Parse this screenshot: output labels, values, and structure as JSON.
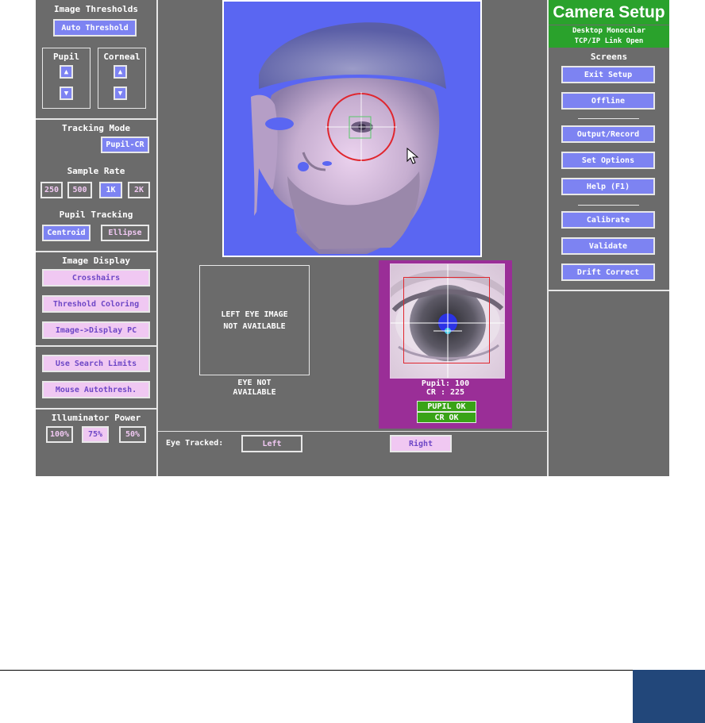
{
  "left": {
    "image_thresholds": {
      "title": "Image Thresholds",
      "auto_threshold": "Auto Threshold",
      "pupil_label": "Pupil",
      "corneal_label": "Corneal"
    },
    "tracking_mode": {
      "title": "Tracking Mode",
      "value": "Pupil-CR"
    },
    "sample_rate": {
      "title": "Sample Rate",
      "options": [
        "250",
        "500",
        "1K",
        "2K"
      ],
      "selected": "1K"
    },
    "pupil_tracking": {
      "title": "Pupil Tracking",
      "centroid": "Centroid",
      "ellipse": "Ellipse"
    },
    "image_display": {
      "title": "Image Display",
      "crosshairs": "Crosshairs",
      "threshold_coloring": "Threshold Coloring",
      "image_display_pc": "Image->Display PC"
    },
    "use_search_limits": "Use Search Limits",
    "mouse_autothresh": "Mouse Autothresh.",
    "illuminator": {
      "title": "Illuminator Power",
      "options": [
        "100%",
        "75%",
        "50%"
      ],
      "selected": "75%"
    }
  },
  "center": {
    "left_eye_msg_1": "LEFT EYE IMAGE",
    "left_eye_msg_2": "NOT AVAILABLE",
    "eye_not_1": "EYE NOT",
    "eye_not_2": "AVAILABLE",
    "pupil_readout": "Pupil: 100",
    "cr_readout": "CR   : 225",
    "pupil_status": "PUPIL OK",
    "cr_status": "CR   OK",
    "eye_tracked_label": "Eye Tracked:",
    "left_btn": "Left",
    "right_btn": "Right"
  },
  "right": {
    "title": "Camera Setup",
    "subtitle_1": "Desktop Monocular",
    "subtitle_2": "TCP/IP Link Open",
    "screens_label": "Screens",
    "buttons": {
      "exit_setup": "Exit Setup",
      "offline": "Offline",
      "output_record": "Output/Record",
      "set_options": "Set Options",
      "help": "Help (F1)",
      "calibrate": "Calibrate",
      "validate": "Validate",
      "drift_correct": "Drift Correct"
    }
  },
  "colors": {
    "panel_gray": "#6b6b6b",
    "button_blue": "#7d83f2",
    "button_pink": "#f0c8f2",
    "header_green": "#2aa22c",
    "status_green": "#39a317",
    "eye_panel_purple": "#9a2e97",
    "footer_blue": "#22477a"
  }
}
